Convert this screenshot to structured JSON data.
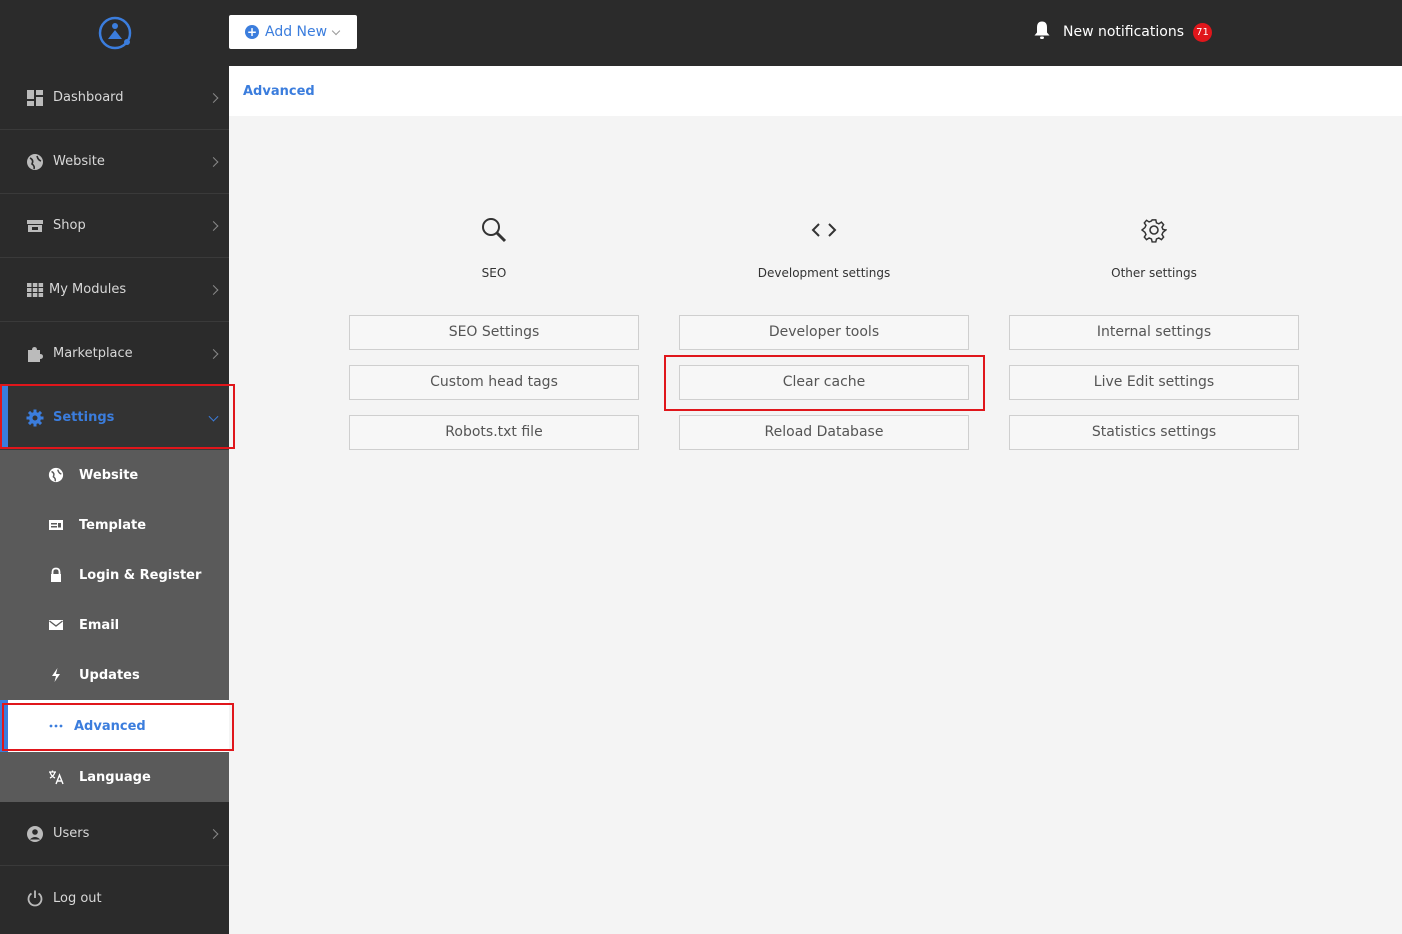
{
  "topbar": {
    "add_new_label": "Add New",
    "notifications_label": "New notifications",
    "notifications_count": "71"
  },
  "sidebar": {
    "items": [
      {
        "label": "Dashboard",
        "icon": "dashboard-icon"
      },
      {
        "label": "Website",
        "icon": "globe-icon"
      },
      {
        "label": "Shop",
        "icon": "store-icon"
      },
      {
        "label": "My Modules",
        "icon": "grid-icon"
      },
      {
        "label": "Marketplace",
        "icon": "puzzle-icon"
      },
      {
        "label": "Settings",
        "icon": "gear-icon",
        "active": true
      }
    ],
    "submenu": [
      {
        "label": "Website",
        "icon": "globe-icon"
      },
      {
        "label": "Template",
        "icon": "template-icon"
      },
      {
        "label": "Login & Register",
        "icon": "lock-icon"
      },
      {
        "label": "Email",
        "icon": "envelope-icon"
      },
      {
        "label": "Updates",
        "icon": "bolt-icon"
      },
      {
        "label": "Advanced",
        "icon": "dots-icon",
        "active": true
      },
      {
        "label": "Language",
        "icon": "translate-icon"
      }
    ],
    "bottom_items": [
      {
        "label": "Users",
        "icon": "user-circle-icon"
      },
      {
        "label": "Log out",
        "icon": "power-icon"
      }
    ]
  },
  "breadcrumb": "Advanced",
  "columns": [
    {
      "title": "SEO",
      "icon": "magnifier-icon",
      "buttons": [
        "SEO Settings",
        "Custom head tags",
        "Robots.txt file"
      ]
    },
    {
      "title": "Development settings",
      "icon": "code-icon",
      "buttons": [
        "Developer tools",
        "Clear cache",
        "Reload Database"
      ]
    },
    {
      "title": "Other settings",
      "icon": "gear-outline-icon",
      "buttons": [
        "Internal settings",
        "Live Edit settings",
        "Statistics settings"
      ]
    }
  ],
  "colors": {
    "accent": "#3b7ddd",
    "sidebar_bg": "#2b2b2b",
    "highlight": "#e0161b"
  }
}
